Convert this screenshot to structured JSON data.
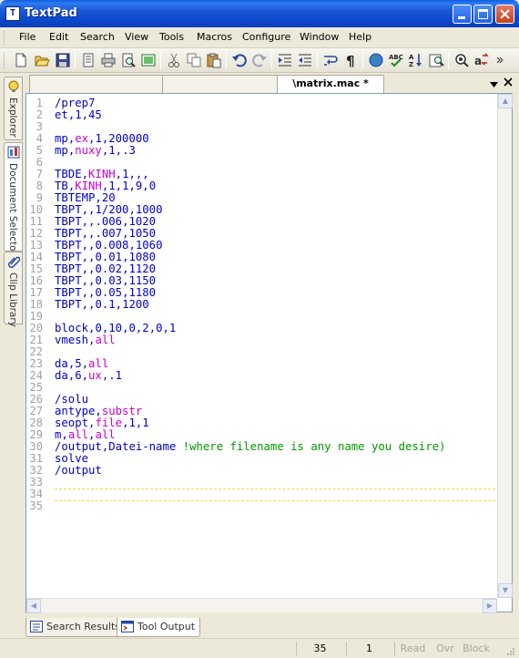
{
  "window": {
    "title": "TextPad",
    "app_icon_glyph": "T"
  },
  "menu": [
    "File",
    "Edit",
    "Search",
    "View",
    "Tools",
    "Macros",
    "Configure",
    "Window",
    "Help"
  ],
  "toolbar_icons": [
    "new-file-icon",
    "open-file-icon",
    "save-icon",
    "save-all-icon",
    "print-icon",
    "print-preview-icon",
    "compare-icon",
    "cut-icon",
    "copy-icon",
    "paste-icon",
    "undo-icon",
    "redo-icon",
    "indent-icon",
    "outdent-icon",
    "word-wrap-icon",
    "pilcrow-icon",
    "web-browser-icon",
    "spellcheck-icon",
    "sort-icon",
    "find-in-files-icon",
    "visual-spaces-icon",
    "replace-icon"
  ],
  "side_tabs": [
    "Explorer",
    "Document Selector",
    "Clip Library"
  ],
  "document": {
    "tab_label": "\\matrix.mac *"
  },
  "editor": {
    "lines": [
      "/prep7",
      "et,1,45",
      "",
      "mp,ex,1,200000",
      "mp,nuxy,1,.3",
      "",
      "TBDE,KINH,1,,,",
      "TB,KINH,1,1,9,0",
      "TBTEMP,20",
      "TBPT,,1/200,1000",
      "TBPT,,.006,1020",
      "TBPT,,.007,1050",
      "TBPT,,0.008,1060",
      "TBPT,,0.01,1080",
      "TBPT,,0.02,1120",
      "TBPT,,0.03,1150",
      "TBPT,,0.05,1180",
      "TBPT,,0.1,1200",
      "",
      "block,0,10,0,2,0,1",
      "vmesh,all",
      "",
      "da,5,all",
      "da,6,ux,.1",
      "",
      "/solu",
      "antype,substr",
      "seopt,file,1,1",
      "m,all,all",
      "/output,Datei-name !where filename is any name you desire)",
      "solve",
      "/output",
      "",
      "",
      ""
    ],
    "line_count": 35,
    "colors": {
      "text": "#0000cc",
      "keyword": "#cc00cc",
      "comment": "#009900",
      "line_number": "#a0a0a0",
      "cursor_line": "#ffd23f"
    }
  },
  "bottom_tabs": [
    "Search Results",
    "Tool Output"
  ],
  "status": {
    "line": "35",
    "column": "1",
    "read": "Read",
    "ovr": "Ovr",
    "block": "Block"
  },
  "colors": {
    "titlebar": "#0b45c8",
    "chrome": "#ece9d8"
  }
}
